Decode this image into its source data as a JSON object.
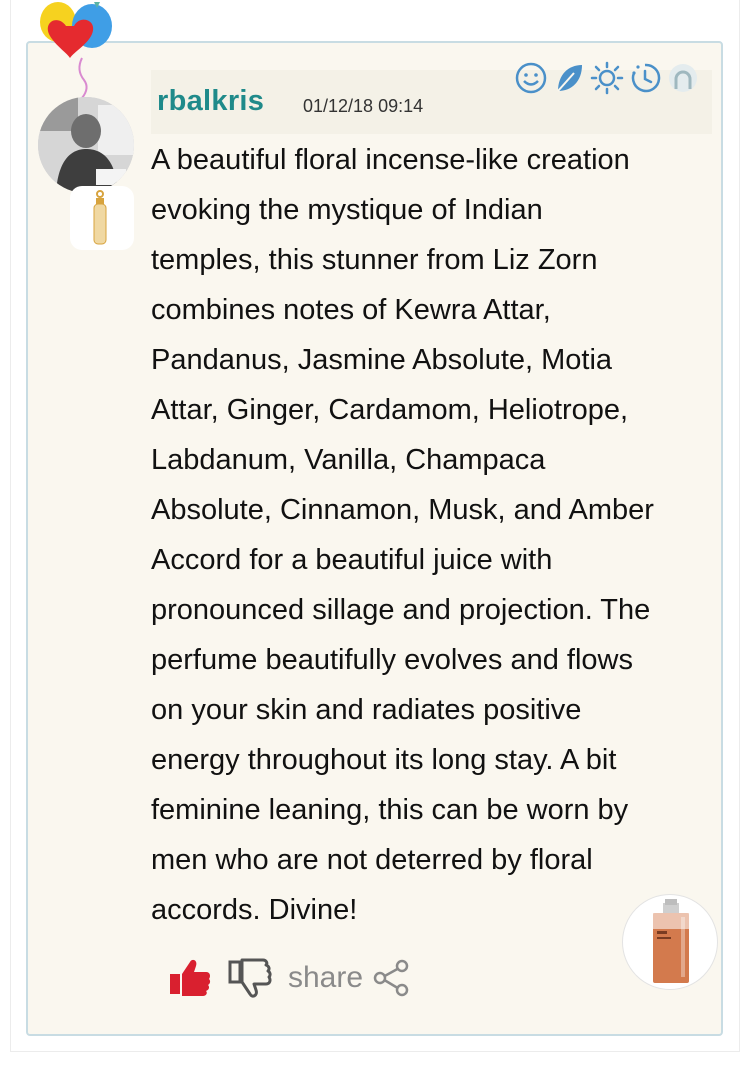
{
  "review": {
    "username": "rbalkris",
    "timestamp": "01/12/18 09:14",
    "text": "A beautiful floral incense-like creation\nevoking the mystique of Indian\ntemples, this stunner from Liz Zorn\ncombines notes of Kewra Attar,\nPandanus, Jasmine Absolute, Motia\nAttar, Ginger, Cardamom, Heliotrope,\nLabdanum, Vanilla, Champaca\nAbsolute, Cinnamon, Musk, and Amber\nAccord for a beautiful juice with\npronounced sillage and projection. The\nperfume beautifully evolves and flows\non your skin and radiates positive\nenergy throughout its long stay. A bit\nfeminine leaning, this can be worn by\nmen who are not deterred by floral\naccords. Divine!"
  },
  "actions": {
    "share_label": "share"
  },
  "rating_icons": [
    "smiley-icon",
    "leaf-icon",
    "sun-icon",
    "clock-icon",
    "person-icon"
  ],
  "colors": {
    "username": "#1f8a8a",
    "icon_blue": "#4a90c9",
    "thumb_up": "#d9202f",
    "card_bg": "#faf7ef",
    "card_border": "#c8dce3"
  }
}
